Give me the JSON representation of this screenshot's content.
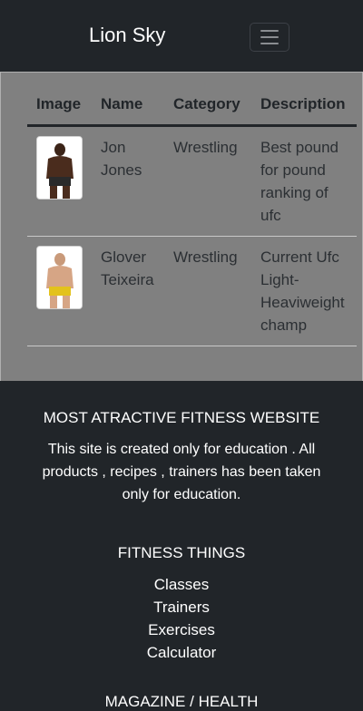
{
  "navbar": {
    "brand": "Lion Sky",
    "toggler_icon": "hamburger-menu-icon"
  },
  "table": {
    "headers": [
      "Image",
      "Name",
      "Category",
      "Description"
    ],
    "rows": [
      {
        "image_icon": "fighter-photo-icon",
        "name_line1": "Jon",
        "name_line2": "Jones",
        "category": "Wrestling",
        "description_lines": [
          "Best pound",
          "for pound",
          "ranking of",
          "ufc"
        ]
      },
      {
        "image_icon": "fighter-photo-icon",
        "name_line1": "Glover",
        "name_line2": "Teixeira",
        "category": "Wrestling",
        "description_lines": [
          "Current Ufc",
          "Light-",
          "Heaviweight",
          "champ"
        ]
      }
    ]
  },
  "footer": {
    "heading1": "MOST ATRACTIVE FITNESS WEBSITE",
    "text1_line1": "This site is created only for education . All",
    "text1_line2": "products , recipes , trainers has been taken",
    "text1_line3": "only for education.",
    "heading2": "FITNESS THINGS",
    "links": [
      "Classes",
      "Trainers",
      "Exercises",
      "Calculator"
    ],
    "heading3": "MAGAZINE / HEALTH"
  },
  "colors": {
    "background": "#212529",
    "table_bg": "#808080",
    "text_dark": "#212529"
  }
}
